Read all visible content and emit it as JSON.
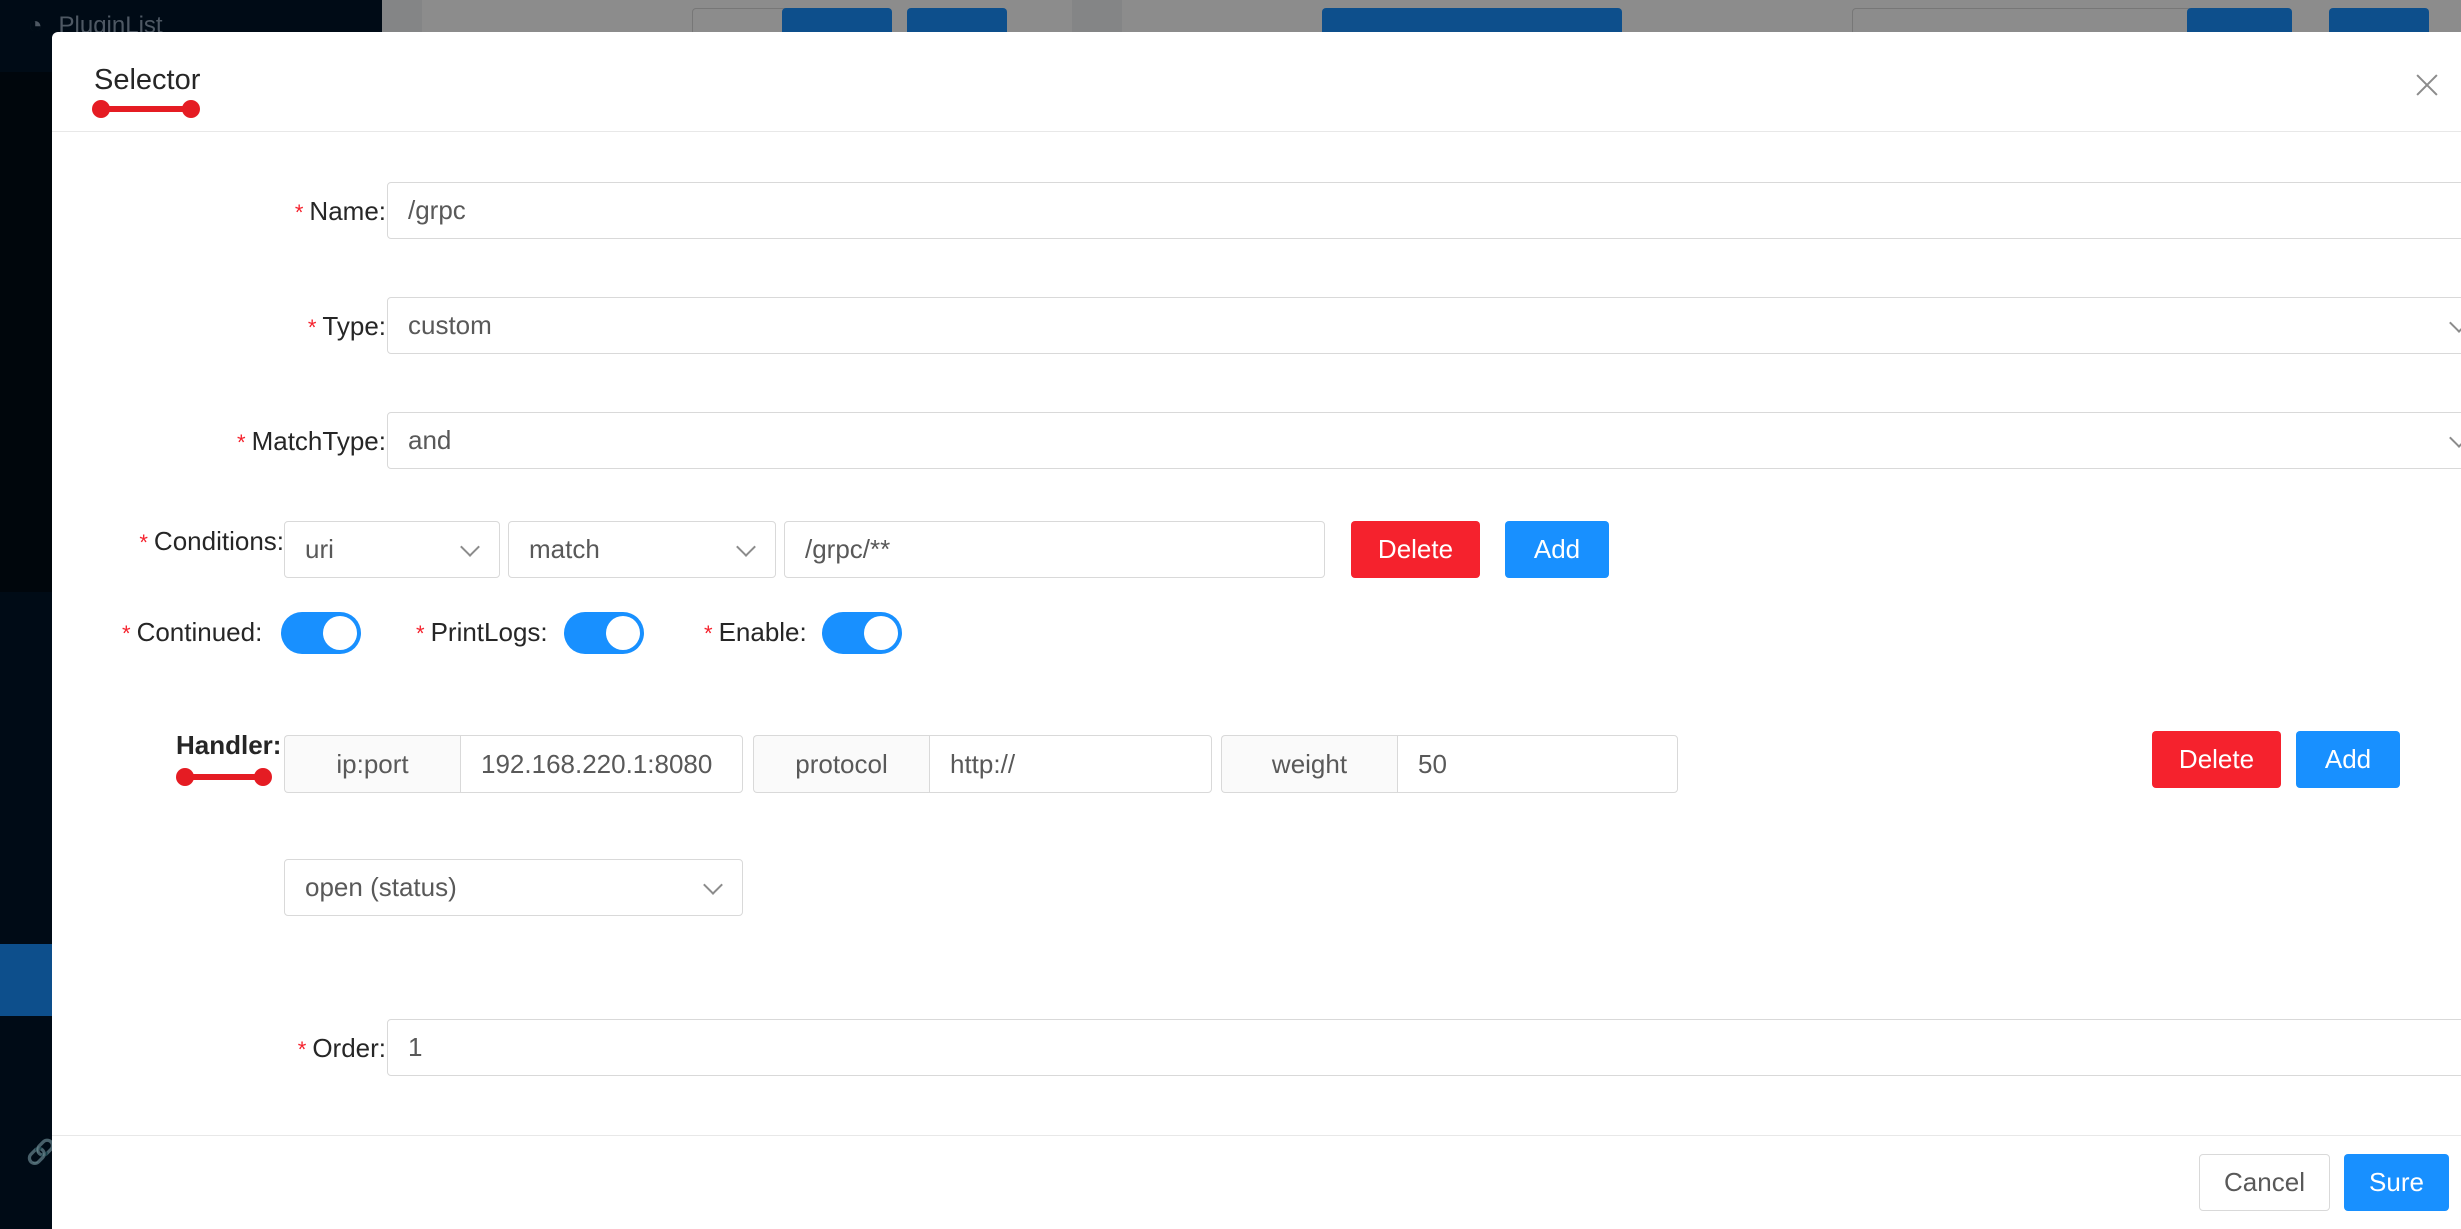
{
  "background": {
    "sidebar_title": "PluginList"
  },
  "modal": {
    "title": "Selector",
    "fields": {
      "name": {
        "label": "Name:",
        "value": "/grpc"
      },
      "type": {
        "label": "Type:",
        "value": "custom"
      },
      "match_type": {
        "label": "MatchType:",
        "value": "and"
      },
      "conditions": {
        "label": "Conditions:",
        "param_type": "uri",
        "operator": "match",
        "value": "/grpc/**",
        "delete_label": "Delete",
        "add_label": "Add"
      },
      "continued": {
        "label": "Continued:",
        "on": true
      },
      "print_logs": {
        "label": "PrintLogs:",
        "on": true
      },
      "enable": {
        "label": "Enable:",
        "on": true
      },
      "handler": {
        "label": "Handler:",
        "ip_port_label": "ip:port",
        "ip_port_value": "192.168.220.1:8080",
        "protocol_label": "protocol",
        "protocol_value": "http://",
        "weight_label": "weight",
        "weight_value": "50",
        "status_value": "open (status)",
        "delete_label": "Delete",
        "add_label": "Add"
      },
      "order": {
        "label": "Order:",
        "value": "1"
      }
    },
    "footer": {
      "cancel_label": "Cancel",
      "sure_label": "Sure"
    }
  },
  "colors": {
    "primary": "#1890ff",
    "danger": "#f5222d",
    "annotation": "#e51c23"
  }
}
